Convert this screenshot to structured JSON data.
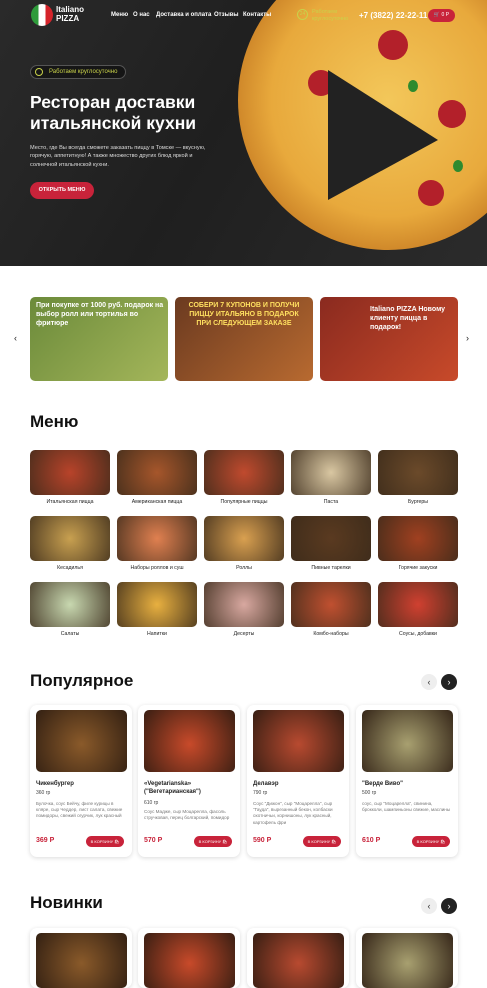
{
  "header": {
    "logo_line1": "Italiano",
    "logo_line2": "PIZZA",
    "nav": [
      "Меню",
      "О нас",
      "Доставка и оплата",
      "Отзывы",
      "Контакты"
    ],
    "work_line1": "Работаем",
    "work_line2": "круглосуточно",
    "phone": "+7 (3822) 22-22-11",
    "cart": "0 Р"
  },
  "hero": {
    "badge": "Работаем круглосуточно",
    "title": "Ресторан доставки итальянской кухни",
    "text": "Место, где Вы всегда сможете заказать пиццу в Томске — вкусную, горячую, аппетитную! А также множество других блюд яркой и солнечной итальянской кухни.",
    "button": "ОТКРЫТЬ МЕНЮ"
  },
  "promos": [
    {
      "text": "При покупке от 1000 руб. подарок на выбор ролл или тортилья во фритюре",
      "color": "#6b8a3a"
    },
    {
      "text": "СОБЕРИ 7 КУПОНОВ И ПОЛУЧИ ПИЦЦУ ИТАЛЬЯНО В ПОДАРОК ПРИ СЛЕДУЮЩЕМ ЗАКАЗЕ",
      "color": "#6b3a20"
    },
    {
      "text": "Italiano PIZZA Новому клиенту пицца в подарок!",
      "color": "#8a2a1f"
    }
  ],
  "menu": {
    "title": "Меню",
    "categories": [
      {
        "label": "Итальянская пицца",
        "color": "#b8432a"
      },
      {
        "label": "Американская пицца",
        "color": "#a6562b"
      },
      {
        "label": "Популярные пиццы",
        "color": "#c04a2e"
      },
      {
        "label": "Паста",
        "color": "#d9c7a2"
      },
      {
        "label": "Бургеры",
        "color": "#6b4a2a"
      },
      {
        "label": "Кесадилья",
        "color": "#c8a050"
      },
      {
        "label": "Наборы роллов и суш",
        "color": "#e08050"
      },
      {
        "label": "Роллы",
        "color": "#d9a050"
      },
      {
        "label": "Пивные тарелки",
        "color": "#5a3a20"
      },
      {
        "label": "Горячие закуски",
        "color": "#a04020"
      },
      {
        "label": "Салаты",
        "color": "#c8d8b0"
      },
      {
        "label": "Напитки",
        "color": "#e8b040"
      },
      {
        "label": "Десерты",
        "color": "#d8a8a0"
      },
      {
        "label": "Комбо-наборы",
        "color": "#c05030"
      },
      {
        "label": "Соусы, добавки",
        "color": "#d04030"
      }
    ]
  },
  "popular": {
    "title": "Популярное",
    "items": [
      {
        "name": "Чикенбургер",
        "weight": "360 гр",
        "desc": "Булочка, соус Бейчу, филе курицы в кляре, сыр Чеддер, лист салата, свежие помидоры, свежий огурчик, лук красный",
        "price": "369 Р",
        "button": "В КОРЗИНУ",
        "color": "#8a5a2a"
      },
      {
        "name": "«Vegetarianska» (\"Вегетарианская\")",
        "weight": "610 гр",
        "desc": "Соус Мадже, сыр Моцарелла, фасоль стручковая, перец болгарский, помидор",
        "price": "570 Р",
        "button": "В КОРЗИНУ",
        "color": "#c84a2a"
      },
      {
        "name": "Делавэр",
        "weight": "790 гр",
        "desc": "Соус \"Дижон\", сыр \"Моцарелла\", сыр \"Гауда\", вырезанный бекон, колбаски охотничьи, корнишоны, лук красный, картофель фри",
        "price": "590 Р",
        "button": "В КОРЗИНУ",
        "color": "#b84a30"
      },
      {
        "name": "\"Верде Виво\"",
        "weight": "500 гр",
        "desc": "соус, сыр \"Моцарелла\", свинина, брокколи, шампиньоны свежие, маслины",
        "price": "610 Р",
        "button": "В КОРЗИНУ",
        "color": "#a8a070"
      }
    ]
  },
  "new": {
    "title": "Новинки",
    "colors": [
      "#8a5a2a",
      "#c84a2a",
      "#b84a30",
      "#a8a070"
    ]
  }
}
